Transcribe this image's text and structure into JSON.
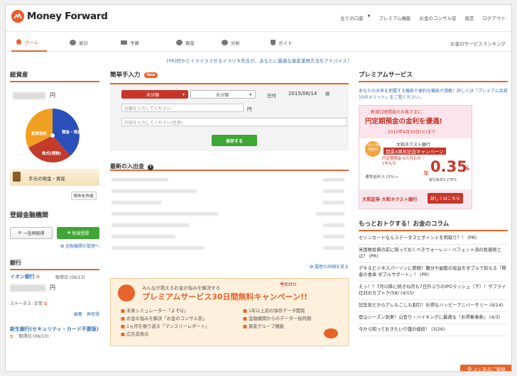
{
  "header": {
    "logo_text": "Money Forward",
    "links": [
      "全ての口座",
      "▼",
      "プレミアム機能",
      "お金のコンサル窓",
      "設定",
      "ログアウト"
    ]
  },
  "nav": {
    "items": [
      "ホーム",
      "家計",
      "予算",
      "資産",
      "分析",
      "ガイド"
    ],
    "ranking": "お金のサービスランキング"
  },
  "banner": "[PR]何かとイライラさせるイラツキ先生が、あなたに最適な資産運用方法をアドバイス！",
  "left": {
    "total_assets_title": "総資産",
    "total_suffix": "円",
    "donut_labels": [
      "預金・現金",
      "株式(現物)",
      "投資信託"
    ],
    "cash_label": "手元の現金・資産",
    "property_button": "財布を作成",
    "registered_title": "登録金融機関",
    "update_all": "一括再取得",
    "new_register": "新規登録",
    "manage_link": "金融機関の管理へ",
    "bank_title": "銀行",
    "bank1_name": "イオン銀行",
    "bank1_fetch": "取得日 (06/13)",
    "bank1_suffix": "円",
    "status_label": "ステータス: 正常",
    "edit": "編集",
    "refetch": "再取得",
    "bank2_name": "新生銀行(セキュリティ・カード不要版)",
    "bank2_fetch": "取得日 (06/13)"
  },
  "middle": {
    "quick_title": "簡単手入力",
    "new_badge": "New",
    "cat_main": "未分類",
    "cat_sub": "未分類",
    "date_label": "日付",
    "date_value": "2015/06/14",
    "amount_placeholder": "金額を入力してください",
    "amount_suffix": "円",
    "content_placeholder": "内容を入力してください(任意)",
    "save_button": "保存する",
    "recent_title": "最新の入出金",
    "history_link": "履歴の詳細を見る",
    "promo_sub": "みんなが抱えるお金の悩みを解決する",
    "promo_now": "今だけ!!",
    "promo_title": "プレミアムサービス30日間無料キャンペーン!!",
    "promo_items_left": [
      "未来シミュレーター「よそQ」",
      "お金の悩みを解決「お金のコンサル窓」",
      "1ヵ月を振り返る「マンスリーレポート」",
      "広告非表示"
    ],
    "promo_items_right": [
      "1年以上前の保存データ閲覧",
      "金融機関からのデーター括同期",
      "資産グループ機能"
    ]
  },
  "right": {
    "premium_title": "プレミアムサービス",
    "premium_desc": "あなたの未来を把握する機能や便利な機能が満載！詳しくは「プレミアム会員 10のメリット」をご覧ください。",
    "ad_line1": "新規口座開設のお客さまに",
    "ad_line2": "円定期預金の金利を優遇!",
    "ad_line3": "2015年6月30日(火)まで",
    "ad_badge": "今だけ特別金利",
    "ad_campaign1": "大和ネクスト銀行",
    "ad_campaign2": "開業4周年記念キャンペーン",
    "ad_term": "円定期預金 6カ月もの・1年もの",
    "ad_rate": "0.35",
    "ad_rate_unit": "%",
    "ad_rate_pre": "年",
    "ad_tax": "税引後年0.278%",
    "ad_base_rate": "通常金利 0.15%→",
    "ad_footer": "大和証券 大和ネクスト銀行",
    "ad_details": "詳しくはこちら",
    "column_title": "もっとおトクする！お金のコラム",
    "articles": [
      "セゾンカードならステータスとポイントを両取り？！ (PR)",
      "米国株投資の前に知っておくべきウォーレン・バフェット流の投資術とは？ (PR)",
      "デキるビジネスパーソンに節税！難分や副筋の収益をダブルで抑える「賢者の食卓 ダブルサポート」！ (PR)",
      "えっ！？7月以降に続きね月も7日外ぶりのIPOラッシュ（下）！ザフライ社対のカブトク(58) (4/15)",
      "記念年だからアレもこしも割引！お得なハッピーアニバーサリー (4/14)",
      "登山シーズン到来！山登り・ハイキングに最適な『お得乗車券』 (4/3)",
      "今から知っておきたい介護の値段！ (3/26)"
    ],
    "faq_button": "よくあるご質問"
  }
}
